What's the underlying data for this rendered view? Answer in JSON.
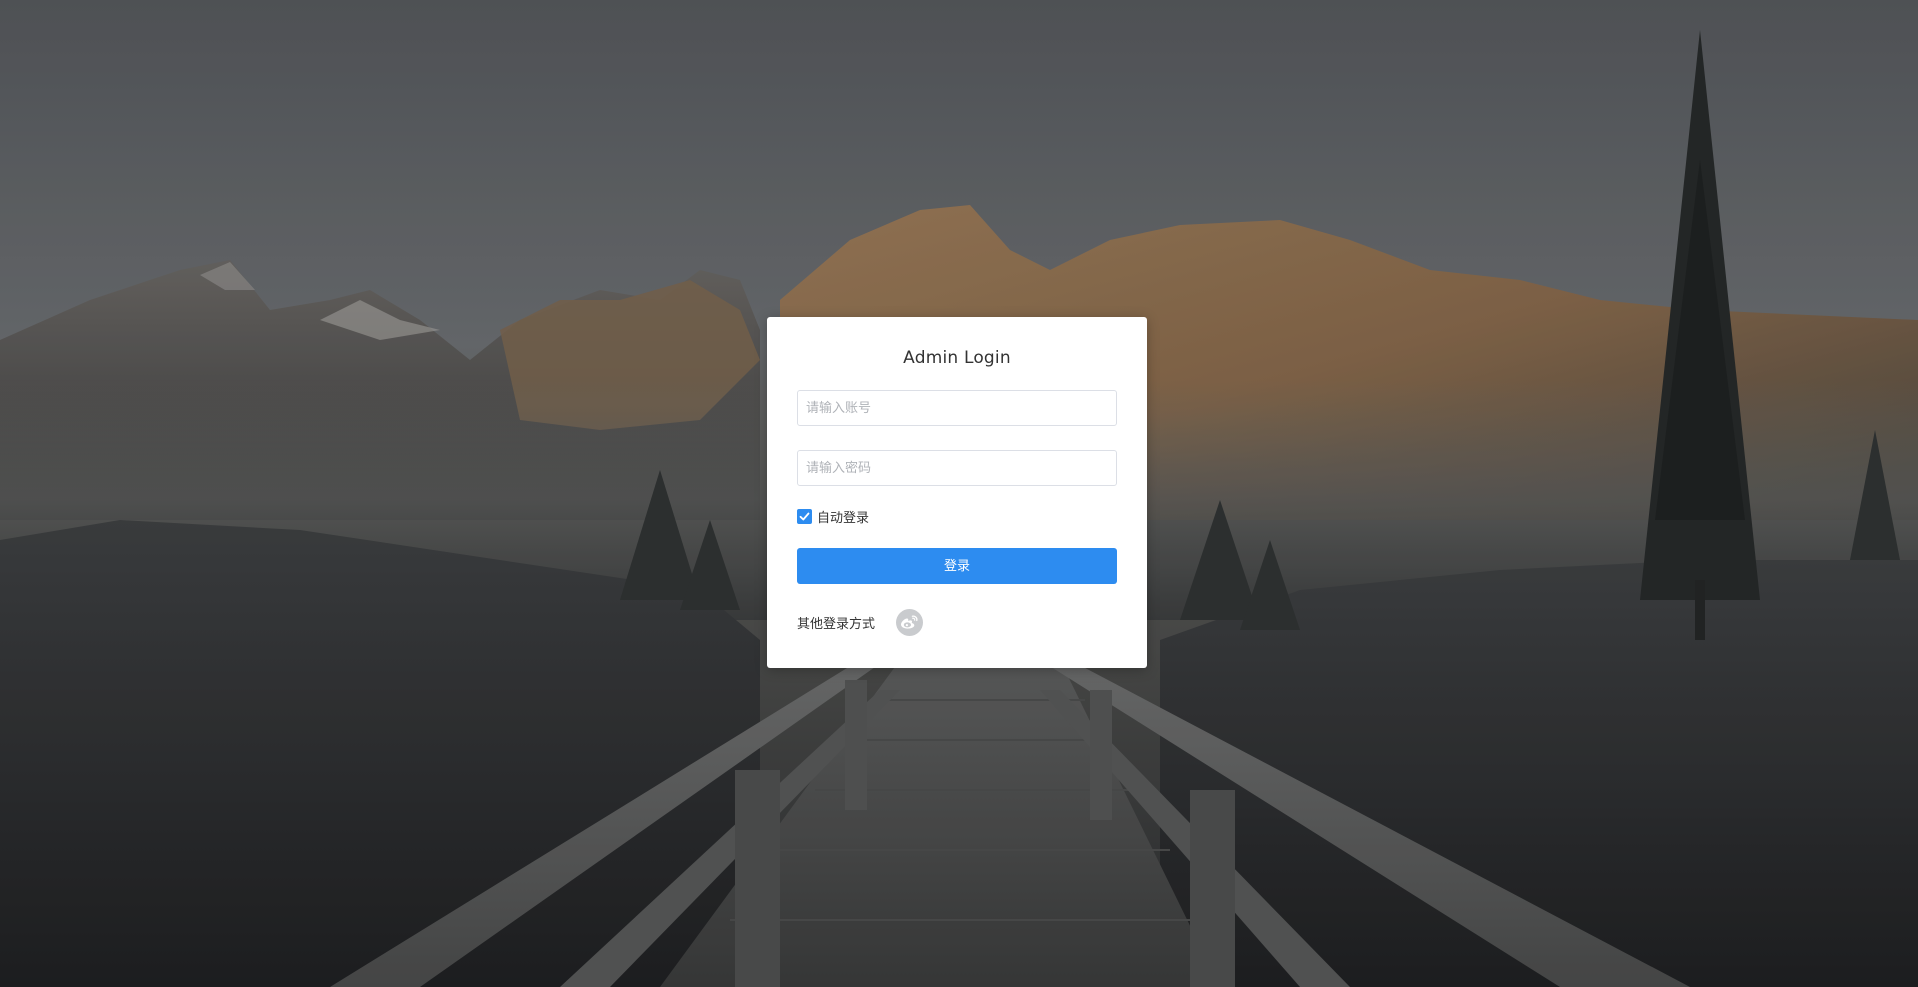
{
  "login": {
    "title": "Admin Login",
    "username_placeholder": "请输入账号",
    "password_placeholder": "请输入密码",
    "remember_label": "自动登录",
    "remember_checked": true,
    "submit_label": "登录",
    "other_login_label": "其他登录方式",
    "other_login_icon": "weibo-icon"
  },
  "colors": {
    "primary": "#2d8cf0",
    "card": "#ffffff",
    "icon_bg": "#c9cbce"
  }
}
